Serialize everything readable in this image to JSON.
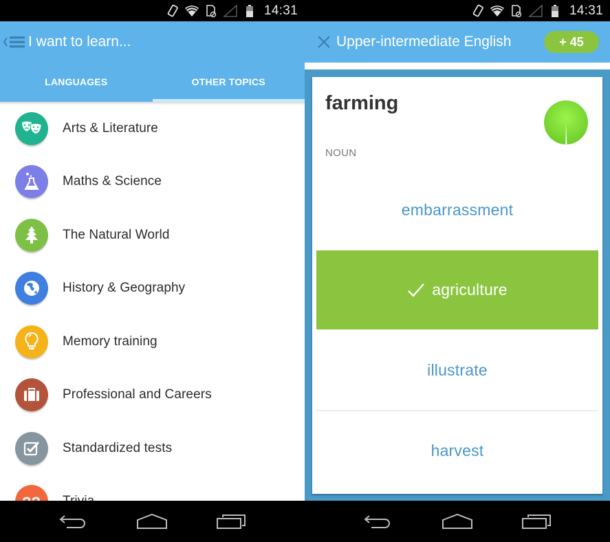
{
  "status_bar": {
    "time": "14:31",
    "icons": [
      "rotate-icon",
      "wifi-icon",
      "sd-card-icon",
      "signal-icon",
      "battery-icon"
    ]
  },
  "left_screen": {
    "app_bar": {
      "title": "I want to learn...",
      "menu_icon": "back-menu-icon"
    },
    "tabs": [
      {
        "label": "LANGUAGES",
        "active": false
      },
      {
        "label": "OTHER TOPICS",
        "active": true
      }
    ],
    "topics": [
      {
        "label": "Arts & Literature",
        "icon": "theater-masks-icon",
        "color": "#21b38f"
      },
      {
        "label": "Maths & Science",
        "icon": "flask-icon",
        "color": "#7b7fe6"
      },
      {
        "label": "The Natural World",
        "icon": "tree-icon",
        "color": "#7ec046"
      },
      {
        "label": "History & Geography",
        "icon": "globe-icon",
        "color": "#3e7fe0"
      },
      {
        "label": "Memory training",
        "icon": "lightbulb-icon",
        "color": "#f5b219"
      },
      {
        "label": "Professional and Careers",
        "icon": "briefcase-icon",
        "color": "#b4533b"
      },
      {
        "label": "Standardized tests",
        "icon": "checkbox-icon",
        "color": "#87959f"
      },
      {
        "label": "Trivia",
        "icon": "question-marks-icon",
        "color": "#f2683c"
      }
    ]
  },
  "right_screen": {
    "app_bar": {
      "title": "Upper-intermediate English",
      "close_icon": "close-icon",
      "score": "+ 45"
    },
    "card": {
      "word": "farming",
      "part_of_speech": "NOUN",
      "timer_fraction_remaining": 0.99,
      "answers": [
        {
          "label": "embarrassment",
          "correct": false
        },
        {
          "label": "agriculture",
          "correct": true
        },
        {
          "label": "illustrate",
          "correct": false
        },
        {
          "label": "harvest",
          "correct": false
        }
      ]
    }
  },
  "nav_bar": {
    "buttons": [
      "back",
      "home",
      "recents"
    ]
  },
  "colors": {
    "app_bar": "#5db3ea",
    "correct_green": "#8bc540",
    "answer_blue": "#4a97c9",
    "card_frame": "#4a9ac8"
  }
}
